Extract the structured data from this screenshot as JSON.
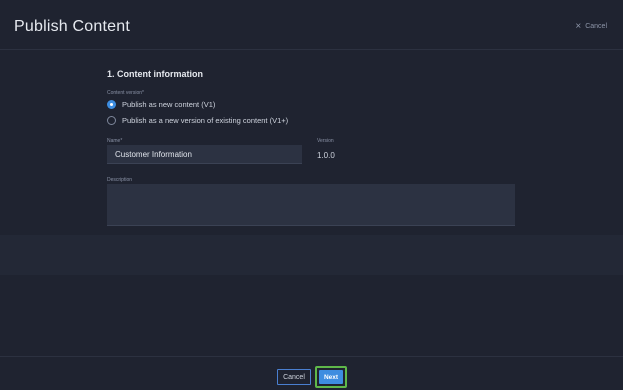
{
  "header": {
    "title": "Publish Content",
    "close_label": "Cancel",
    "close_icon": "close-icon"
  },
  "section": {
    "title": "1. Content information"
  },
  "content_version": {
    "label": "Content version*",
    "options": [
      {
        "label": "Publish as new content (V1)",
        "checked": true
      },
      {
        "label": "Publish as a new version of existing content (V1+)",
        "checked": false
      }
    ]
  },
  "name_field": {
    "label": "Name*",
    "value": "Customer Information"
  },
  "version_field": {
    "label": "Version",
    "value": "1.0.0"
  },
  "description_field": {
    "label": "Description",
    "value": ""
  },
  "footer": {
    "cancel_label": "Cancel",
    "next_label": "Next"
  },
  "colors": {
    "background": "#1f2330",
    "input_bg": "#2c3242",
    "accent": "#3d8de0",
    "highlight": "#5fb84a"
  }
}
